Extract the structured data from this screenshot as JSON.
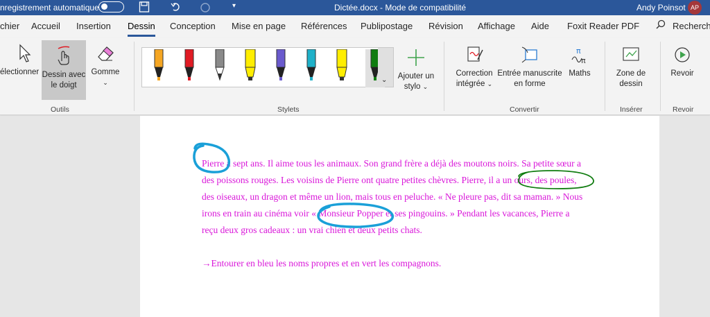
{
  "titlebar": {
    "autosave_label": "nregistrement automatique",
    "document": "Dictée.docx  -  Mode de compatibilité",
    "user": "Andy Poinsot",
    "initials": "AP"
  },
  "tabs": [
    "chier",
    "Accueil",
    "Insertion",
    "Dessin",
    "Conception",
    "Mise en page",
    "Références",
    "Publipostage",
    "Révision",
    "Affichage",
    "Aide",
    "Foxit Reader PDF"
  ],
  "active_tab": "Dessin",
  "search": "Recherch",
  "ribbon": {
    "select": "électionner",
    "touch_line1": "Dessin avec",
    "touch_line2": "le doigt",
    "eraser": "Gomme",
    "group_tools": "Outils",
    "add_pen_line1": "Ajouter un",
    "add_pen_line2": "stylo",
    "group_pens": "Stylets",
    "correction_line1": "Correction",
    "correction_line2": "intégrée",
    "ink_shape_line1": "Entrée manuscrite",
    "ink_shape_line2": "en forme",
    "math": "Maths",
    "group_convert": "Convertir",
    "canvas_line1": "Zone de",
    "canvas_line2": "dessin",
    "group_insert": "Insérer",
    "replay": "Revoir",
    "group_replay": "Revoir"
  },
  "pens": [
    {
      "name": "pen-orange",
      "color": "#f5a623",
      "kind": "pen"
    },
    {
      "name": "pen-red",
      "color": "#e01b24",
      "kind": "pen"
    },
    {
      "name": "pencil-gray",
      "color": "#8a8a8a",
      "kind": "pencil"
    },
    {
      "name": "highlighter-yellow",
      "color": "#ffee00",
      "kind": "highlighter"
    },
    {
      "name": "pen-galaxy",
      "color": "#6a5acd",
      "kind": "pen"
    },
    {
      "name": "pen-teal",
      "color": "#1fb1c9",
      "kind": "pen"
    },
    {
      "name": "highlighter-yellow-2",
      "color": "#ffee00",
      "kind": "highlighter"
    },
    {
      "name": "pen-blue",
      "color": "#1ba1e2",
      "kind": "pen"
    },
    {
      "name": "pen-green",
      "color": "#107c10",
      "kind": "pen"
    }
  ],
  "document": {
    "lines": [
      "Pierre a sept ans. Il aime tous les animaux. Son grand frère a déjà des moutons noirs. Sa petite sœur a",
      "des poissons rouges. Les voisins de Pierre ont quatre petites chèvres. Pierre, il a un ours, des poules,",
      "des oiseaux, un dragon et même un lion, mais tous en peluche. «  Ne pleure pas, dit sa maman. » Nous",
      "irons en train au cinéma voir « Monsieur Popper et ses pingouins. » Pendant les vacances, Pierre a",
      "reçu deux gros cadeaux : un vrai chien et deux petits chats."
    ],
    "instruction": "→Entourer en bleu les noms propres et en vert les compagnons."
  },
  "colors": {
    "accent": "#2b579a",
    "text": "#d916d9",
    "ink_blue": "#1aa0d8",
    "ink_green": "#107c10"
  }
}
